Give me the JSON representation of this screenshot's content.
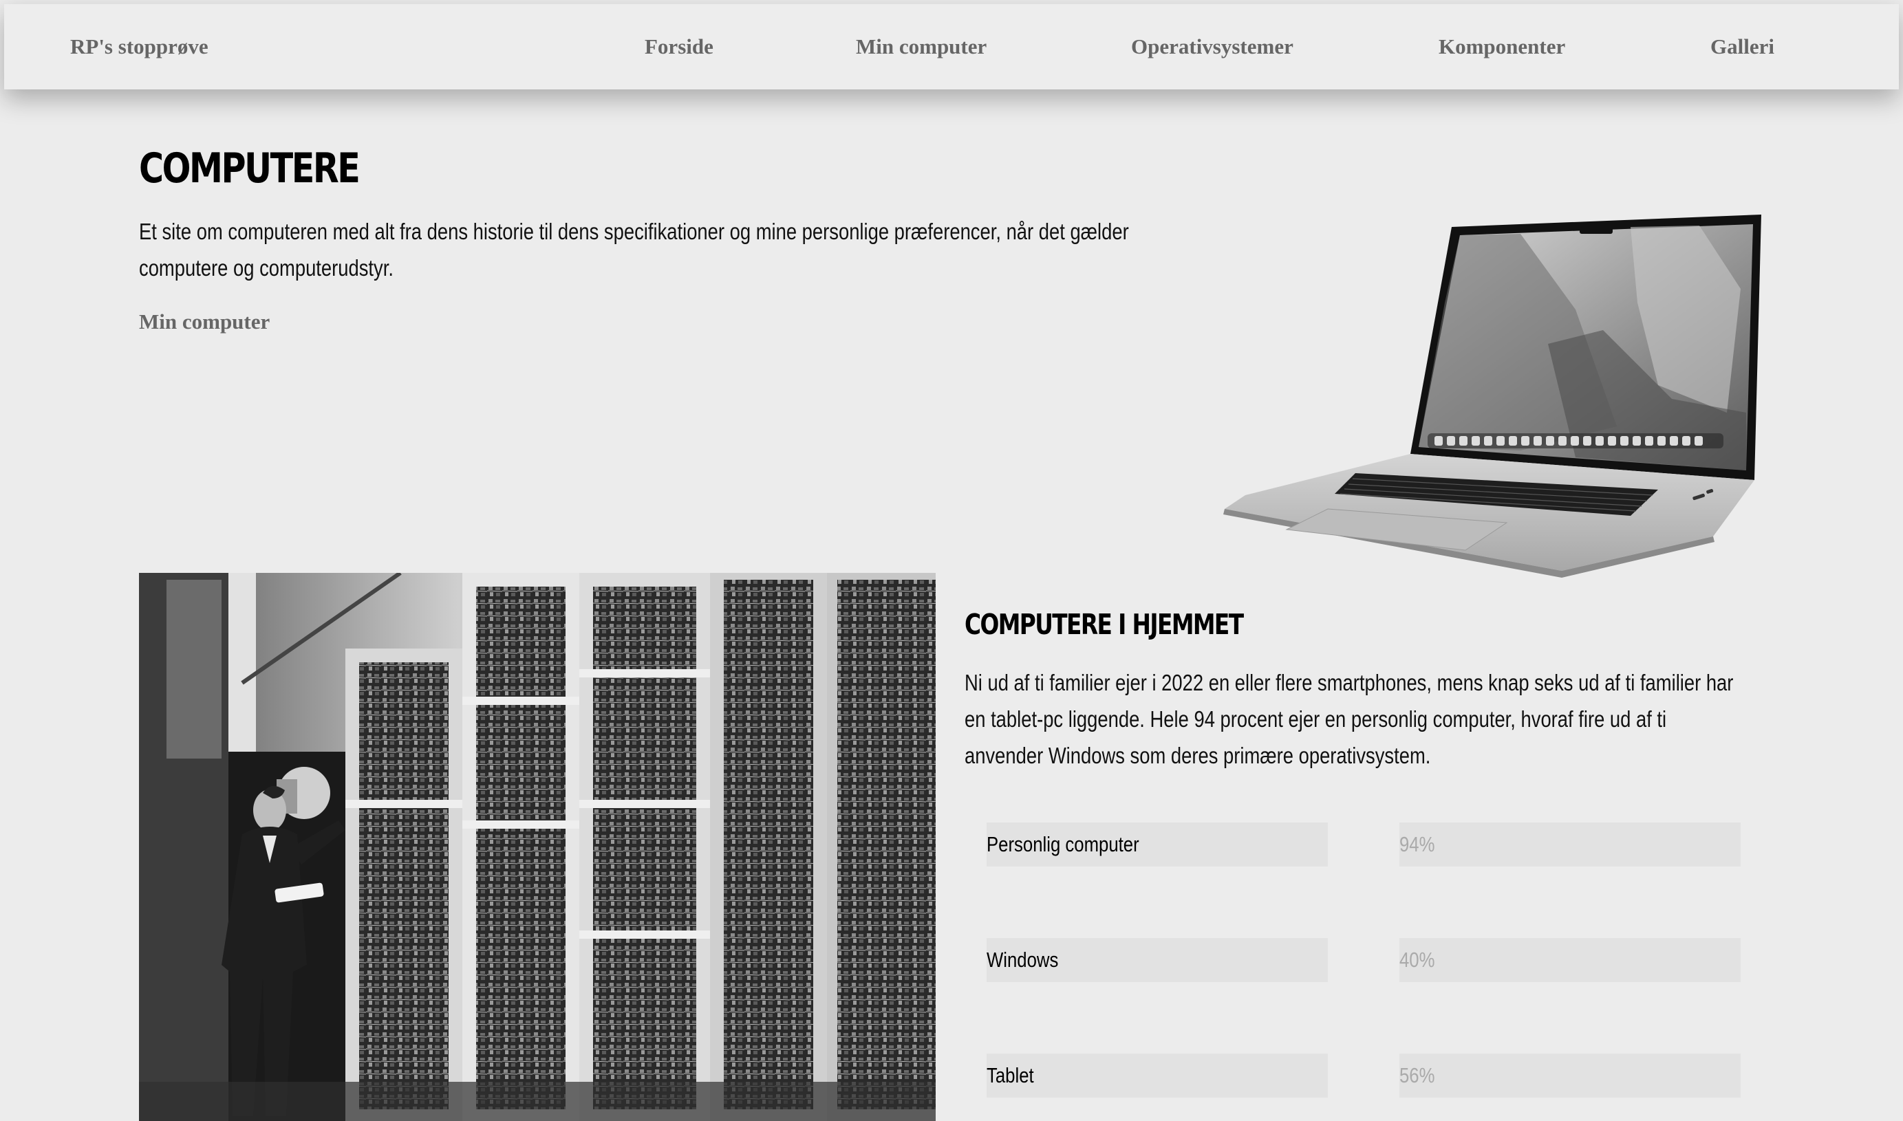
{
  "nav": {
    "brand": "RP's stopprøve",
    "links": [
      "Forside",
      "Min computer",
      "Operativsystemer",
      "Komponenter",
      "Galleri"
    ]
  },
  "hero": {
    "title": "COMPUTERE",
    "text": "Et site om computeren med alt fra dens historie til dens specifikationer og mine personlige præferencer, når det gælder computere og computerudstyr.",
    "link": "Min computer"
  },
  "section": {
    "title": "COMPUTERE I HJEMMET",
    "text": "Ni ud af ti familier ejer i 2022 en eller flere smartphones, mens knap seks ud af ti familier har en tablet-pc liggende. Hele 94 procent ejer en personlig computer, hvoraf fire ud af ti anvender Windows som deres primære operativsystem."
  },
  "stats": [
    {
      "label": "Personlig computer",
      "value": "94%",
      "percent": 94
    },
    {
      "label": "Windows",
      "value": "40%",
      "percent": 40
    },
    {
      "label": "Tablet",
      "value": "56%",
      "percent": 56
    }
  ],
  "colors": {
    "background": "#ececec",
    "nav_text": "#666666",
    "bar_background": "#e2e2e2",
    "stat_value_text": "#aaaaaa"
  },
  "images": {
    "laptop": "laptop-image",
    "mainframe": "mainframe-photo"
  }
}
